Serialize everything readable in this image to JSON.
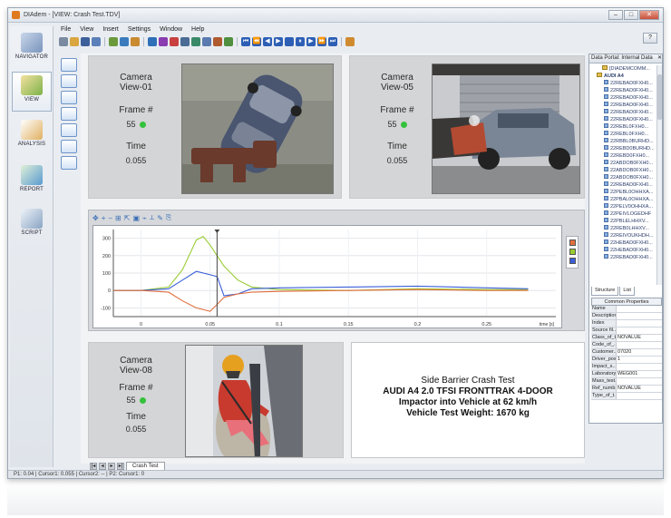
{
  "window": {
    "title": "DIAdem - [VIEW: Crash Test.TDV]"
  },
  "menu": [
    "File",
    "View",
    "Insert",
    "Settings",
    "Window",
    "Help"
  ],
  "navigator": [
    {
      "label": "NAVIGATOR",
      "icon": "navigator-icon"
    },
    {
      "label": "VIEW",
      "icon": "view-icon",
      "active": true
    },
    {
      "label": "ANALYSIS",
      "icon": "analysis-icon"
    },
    {
      "label": "REPORT",
      "icon": "report-icon"
    },
    {
      "label": "SCRIPT",
      "icon": "script-icon"
    }
  ],
  "cameras": [
    {
      "name_line1": "Camera",
      "name_line2": "View-01",
      "frame_label": "Frame #",
      "frame": "55",
      "time_label": "Time",
      "time": "0.055"
    },
    {
      "name_line1": "Camera",
      "name_line2": "View-05",
      "frame_label": "Frame #",
      "frame": "55",
      "time_label": "Time",
      "time": "0.055"
    },
    {
      "name_line1": "Camera",
      "name_line2": "View-08",
      "frame_label": "Frame #",
      "frame": "55",
      "time_label": "Time",
      "time": "0.055"
    }
  ],
  "description": {
    "line1": "Side Barrier Crash Test",
    "line2": "AUDI A4 2.0 TFSI FRONTTRAK 4-DOOR",
    "line3": "Impactor into Vehicle at 62 km/h",
    "line4": "Vehicle Test Weight: 1670 kg"
  },
  "chart_data": {
    "type": "line",
    "xlabel": "time [s]",
    "ylabel": "",
    "xlim": [
      -0.02,
      0.3
    ],
    "ylim": [
      -150,
      350
    ],
    "xticks": [
      "0",
      "0.05",
      "0.1",
      "0.15",
      "0.2",
      "0.25"
    ],
    "yticks": [
      "300",
      "200",
      "100",
      "0",
      "-100"
    ],
    "cursor_x": 0.055,
    "series": [
      {
        "color": "#9acd32",
        "x": [
          -0.02,
          0.0,
          0.02,
          0.03,
          0.04,
          0.045,
          0.05,
          0.055,
          0.06,
          0.07,
          0.08,
          0.1,
          0.15,
          0.2,
          0.25,
          0.28
        ],
        "y": [
          0,
          0,
          20,
          120,
          290,
          310,
          260,
          200,
          140,
          60,
          20,
          5,
          0,
          10,
          5,
          5
        ]
      },
      {
        "color": "#3a5fd8",
        "x": [
          -0.02,
          0.0,
          0.02,
          0.03,
          0.04,
          0.05,
          0.055,
          0.06,
          0.07,
          0.08,
          0.1,
          0.15,
          0.2,
          0.25,
          0.28
        ],
        "y": [
          0,
          0,
          10,
          60,
          110,
          90,
          80,
          -30,
          -20,
          10,
          15,
          20,
          25,
          15,
          10
        ]
      },
      {
        "color": "#e07040",
        "x": [
          -0.02,
          0.0,
          0.02,
          0.03,
          0.04,
          0.05,
          0.055,
          0.06,
          0.07,
          0.08,
          0.1,
          0.15,
          0.2,
          0.25,
          0.28
        ],
        "y": [
          0,
          0,
          -10,
          -60,
          -100,
          -120,
          -80,
          -40,
          -20,
          -10,
          -5,
          0,
          5,
          0,
          0
        ]
      }
    ]
  },
  "sheet_tab": "Crash Test",
  "statusbar": "P1: 0.04 | Cursor1: 0.055 | Cursor2: -- | P2: Cursor1: 0",
  "portal": {
    "title": "Data Portal: Internal Data",
    "tree_root": "[DIADEMCOMM...",
    "tree_group": "AUDI A4",
    "channels": [
      "22REBAD0FXH0...",
      "22REBAD0FXH0...",
      "22REBAD0FXH0...",
      "22REBAD0FXH0...",
      "22REBAD0FXH0...",
      "22REBAD0FXH0...",
      "22REBL0FXH0...",
      "22REBL0FXH0...",
      "22RBBL0BURHD...",
      "22REBD0BURHD...",
      "22REBD0FXH0...",
      "22ABDOB0FXH0...",
      "22ABDOB0FXH0...",
      "22ABDOB0FXH0...",
      "22REBAD0FXH0...",
      "22PEBL0OHHXA...",
      "22PBAL0OHHXA...",
      "22PELV0OHHXA...",
      "22PEIVLOGEDHF",
      "22PBLELHHXV...",
      "22REB0LHHXV...",
      "22REIVOUKHDH...",
      "22HEBAD0FXH0...",
      "22HEBAD0FXH0...",
      "22REBAD0FXH0..."
    ],
    "tabs": [
      "Structure",
      "List"
    ],
    "props_title": "Common Properties",
    "props": [
      {
        "k": "Name",
        "v": ""
      },
      {
        "k": "Description",
        "v": ""
      },
      {
        "k": "Index",
        "v": ""
      },
      {
        "k": "Source fil...",
        "v": ""
      },
      {
        "k": "Class_of_t...",
        "v": "NOVALUE"
      },
      {
        "k": "Code_of_...",
        "v": ""
      },
      {
        "k": "Customer...",
        "v": "07020"
      },
      {
        "k": "Driver_pos...",
        "v": "1"
      },
      {
        "k": "Impact_s...",
        "v": ""
      },
      {
        "k": "Laboratory...",
        "v": "WEG001"
      },
      {
        "k": "Mass_test...",
        "v": ""
      },
      {
        "k": "Ref_numb...",
        "v": "NOVALUE"
      },
      {
        "k": "Type_of_t...",
        "v": ""
      }
    ]
  }
}
